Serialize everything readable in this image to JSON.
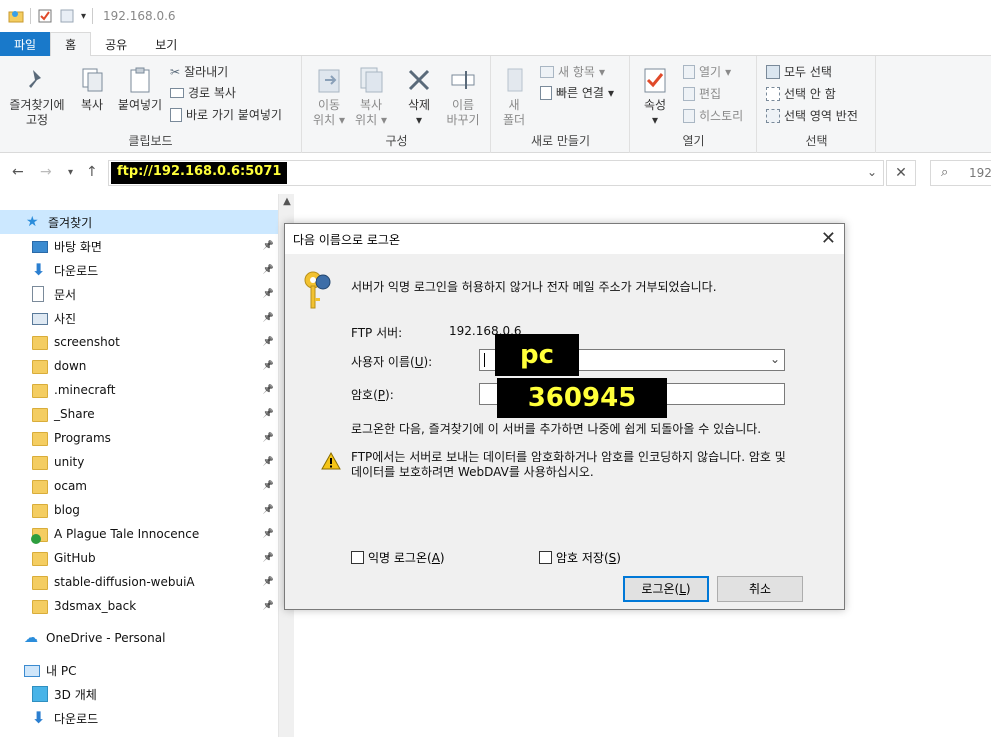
{
  "window": {
    "title": "192.168.0.6"
  },
  "tabs": [
    {
      "label": "파일"
    },
    {
      "label": "홈"
    },
    {
      "label": "공유"
    },
    {
      "label": "보기"
    }
  ],
  "ribbon": {
    "clipboard": {
      "label": "클립보드",
      "pin_label_1": "즐겨찾기에",
      "pin_label_2": "고정",
      "copy": "복사",
      "paste": "붙여넣기",
      "cut": "잘라내기",
      "copy_path": "경로 복사",
      "paste_shortcut": "바로 가기 붙여넣기"
    },
    "organize": {
      "label": "구성",
      "move_1": "이동",
      "move_2": "위치",
      "copy_1": "복사",
      "copy_2": "위치",
      "delete": "삭제",
      "rename_1": "이름",
      "rename_2": "바꾸기"
    },
    "new": {
      "label": "새로 만들기",
      "folder_1": "새",
      "folder_2": "폴더",
      "new_item": "새 항목",
      "easy_access": "빠른 연결"
    },
    "open": {
      "label": "열기",
      "properties": "속성",
      "open": "열기",
      "edit": "편집",
      "history": "히스토리"
    },
    "select": {
      "label": "선택",
      "select_all": "모두 선택",
      "select_none": "선택 안 함",
      "invert": "선택 영역 반전"
    }
  },
  "address": {
    "path": "ftp://192.168.0.6:5071",
    "search_text": "192"
  },
  "sidebar": {
    "quick_access": "즐겨찾기",
    "items": [
      {
        "label": "바탕 화면",
        "icon": "desktop-icon"
      },
      {
        "label": "다운로드",
        "icon": "download-icon"
      },
      {
        "label": "문서",
        "icon": "document-icon"
      },
      {
        "label": "사진",
        "icon": "picture-icon"
      },
      {
        "label": "screenshot",
        "icon": "folder-icon"
      },
      {
        "label": "down",
        "icon": "folder-icon"
      },
      {
        "label": ".minecraft",
        "icon": "folder-icon"
      },
      {
        "label": "_Share",
        "icon": "folder-icon"
      },
      {
        "label": "Programs",
        "icon": "folder-icon"
      },
      {
        "label": "unity",
        "icon": "folder-icon"
      },
      {
        "label": "ocam",
        "icon": "folder-icon"
      },
      {
        "label": "blog",
        "icon": "folder-icon"
      },
      {
        "label": "A Plague Tale Innocence",
        "icon": "folder-check-icon"
      },
      {
        "label": "GitHub",
        "icon": "folder-icon"
      },
      {
        "label": "stable-diffusion-webuiA",
        "icon": "folder-icon"
      },
      {
        "label": "3dsmax_back",
        "icon": "folder-icon"
      }
    ],
    "onedrive": "OneDrive - Personal",
    "this_pc": "내 PC",
    "pc_items": [
      {
        "label": "3D 개체"
      },
      {
        "label": "다운로드"
      }
    ]
  },
  "dialog": {
    "title": "다음 이름으로 로그온",
    "message": "서버가 익명 로그인을 허용하지 않거나 전자 메일 주소가 거부되었습니다.",
    "server_label": "FTP 서버:",
    "server_value": "192.168.0.6",
    "username_label_pre": "사용자 이름(",
    "username_label_key": "U",
    "username_label_post": "):",
    "username_value": "pc",
    "password_label_pre": "암호(",
    "password_label_key": "P",
    "password_label_post": "):",
    "password_value": "360945",
    "favorites_note": "로그온한 다음, 즐겨찾기에 이 서버를 추가하면 나중에 쉽게 되돌아올 수 있습니다.",
    "warning_text_1": "FTP에서는 서버로 보내는 데이터를 암호화하거나 암호를 인코딩하지 않습니다. 암호 및",
    "warning_text_2": "데이터를 보호하려면 WebDAV를 사용하십시오.",
    "anon_label_pre": "익명 로그온(",
    "anon_label_key": "A",
    "anon_label_post": ")",
    "save_pw_pre": "암호 저장(",
    "save_pw_key": "S",
    "save_pw_post": ")",
    "logon_pre": "로그온(",
    "logon_key": "L",
    "logon_post": ")",
    "cancel": "취소"
  },
  "colors": {
    "accent": "#1979ca",
    "mask_bg": "#000000",
    "mask_text": "#ffff3a",
    "selection": "#cce8ff"
  }
}
